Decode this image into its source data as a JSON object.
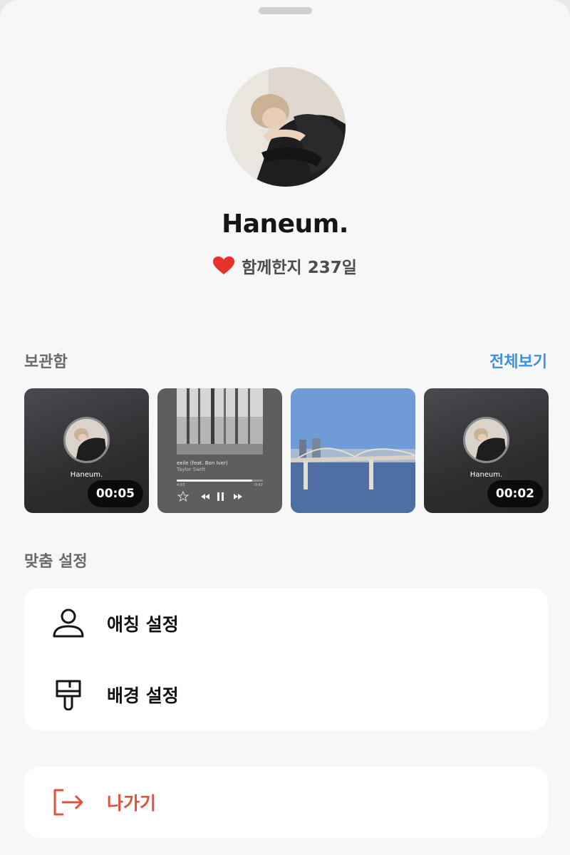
{
  "profile": {
    "name": "Haneum.",
    "together_text": "함께한지 237일"
  },
  "archive": {
    "title": "보관함",
    "see_all": "전체보기",
    "items": [
      {
        "type": "profile-card",
        "name": "Haneum.",
        "duration": "00:05"
      },
      {
        "type": "music-card",
        "song": "exile (feat. Bon Iver)",
        "artist": "Taylor Swift",
        "elapsed": "4:03",
        "remaining": "-0:42",
        "progress": 0.88
      },
      {
        "type": "photo",
        "icon": "photo-bridge"
      },
      {
        "type": "profile-card",
        "name": "Haneum.",
        "duration": "00:02"
      }
    ]
  },
  "custom": {
    "title": "맞춤 설정",
    "nickname_label": "애칭 설정",
    "background_label": "배경 설정"
  },
  "exit": {
    "label": "나가기"
  },
  "colors": {
    "accent_blue": "#3d8fe6",
    "exit_red": "#e0523f",
    "heart_red": "#e5332a",
    "background": "#f7f7f7"
  }
}
